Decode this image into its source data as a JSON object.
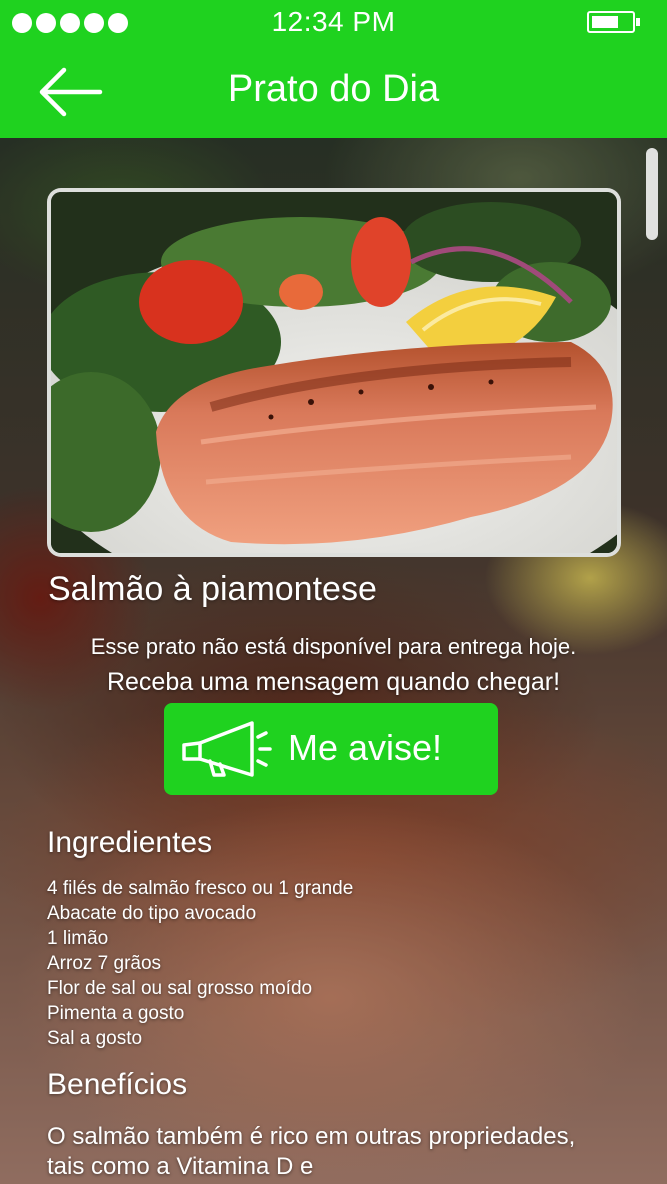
{
  "status_bar": {
    "time": "12:34 PM",
    "signal_dots": 5,
    "battery_level": 0.6
  },
  "header": {
    "title": "Prato do Dia",
    "back_icon": "arrow-left-icon"
  },
  "colors": {
    "accent": "#1fd21f",
    "text": "#ffffff"
  },
  "dish": {
    "name": "Salmão à piamontese",
    "image": "grilled salmon with salad"
  },
  "availability": {
    "line1": "Esse prato não está disponível para entrega hoje.",
    "line2": "Receba uma mensagem quando chegar!"
  },
  "notify_button": {
    "label": "Me avise!",
    "icon": "megaphone-icon"
  },
  "ingredients": {
    "title": "Ingredientes",
    "items": [
      "4 filés de salmão fresco ou 1 grande",
      "Abacate do tipo avocado",
      "1 limão",
      "Arroz 7 grãos",
      "Flor de sal ou sal grosso moído",
      "Pimenta a gosto",
      "Sal a gosto"
    ]
  },
  "benefits": {
    "title": "Benefícios",
    "text": "O salmão também é rico em outras propriedades, tais como a Vitamina D e"
  }
}
